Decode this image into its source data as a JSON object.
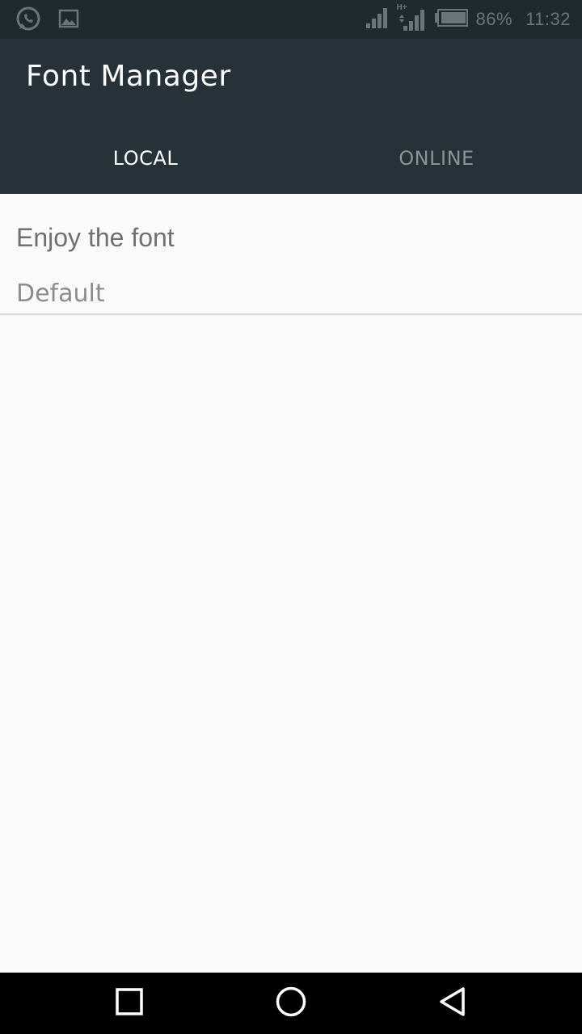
{
  "status_bar": {
    "left_icons": [
      "whatsapp-icon",
      "image-icon"
    ],
    "battery_percent": "86%",
    "time": "11:32",
    "network_label": "H+"
  },
  "app_bar": {
    "title": "Font Manager",
    "tabs": [
      {
        "label": "LOCAL",
        "active": true
      },
      {
        "label": "ONLINE",
        "active": false
      }
    ]
  },
  "fonts": [
    {
      "title": "Enjoy the font",
      "name": "Default"
    }
  ],
  "nav_bar": {
    "icons": [
      "recents-square-icon",
      "home-circle-icon",
      "back-triangle-icon"
    ]
  },
  "colors": {
    "status_bar_bg": "#1f292e",
    "app_bar_bg": "#263238",
    "content_bg": "#fafafa",
    "active_tab": "#ffffff",
    "inactive_tab": "#8a9398"
  }
}
